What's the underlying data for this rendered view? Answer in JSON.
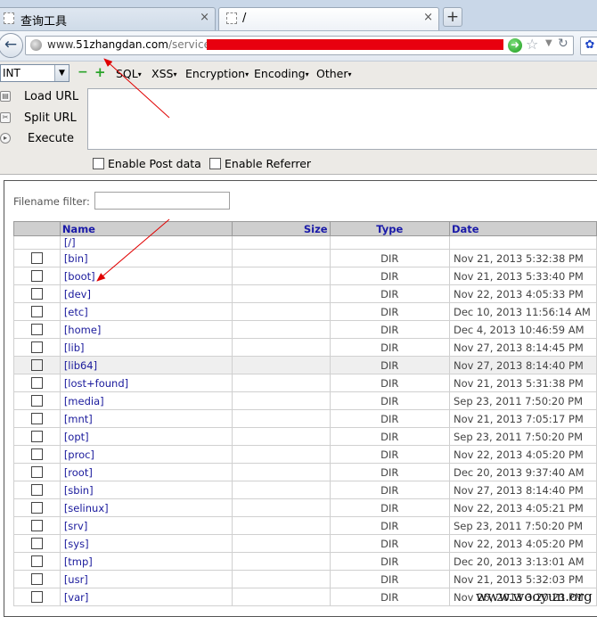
{
  "tabs": [
    {
      "title": "查询工具",
      "close": "×"
    },
    {
      "title": "/",
      "close": "×"
    }
  ],
  "new_tab_label": "+",
  "address": {
    "host_prefix": "www.",
    "host": "51zhangdan.com",
    "path_visible": "/service/",
    "redaction_color": "#e8000f"
  },
  "hackbar": {
    "select_value": "INT",
    "minus": "−",
    "plus": "+",
    "menus": [
      "SQL",
      "XSS",
      "Encryption",
      "Encoding",
      "Other"
    ],
    "actions": [
      "Load URL",
      "Split URL",
      "Execute"
    ],
    "checkboxes": [
      "Enable Post data",
      "Enable Referrer"
    ]
  },
  "filter_label": "Filename filter:",
  "table": {
    "headers": [
      "Name",
      "Size",
      "Type",
      "Date"
    ],
    "parent": "[/]",
    "rows": [
      {
        "name": "[bin]",
        "type": "DIR",
        "date": "Nov 21, 2013 5:32:38 PM"
      },
      {
        "name": "[boot]",
        "type": "DIR",
        "date": "Nov 21, 2013 5:33:40 PM"
      },
      {
        "name": "[dev]",
        "type": "DIR",
        "date": "Nov 22, 2013 4:05:33 PM"
      },
      {
        "name": "[etc]",
        "type": "DIR",
        "date": "Dec 10, 2013 11:56:14 AM"
      },
      {
        "name": "[home]",
        "type": "DIR",
        "date": "Dec 4, 2013 10:46:59 AM"
      },
      {
        "name": "[lib]",
        "type": "DIR",
        "date": "Nov 27, 2013 8:14:45 PM"
      },
      {
        "name": "[lib64]",
        "type": "DIR",
        "date": "Nov 27, 2013 8:14:40 PM"
      },
      {
        "name": "[lost+found]",
        "type": "DIR",
        "date": "Nov 21, 2013 5:31:38 PM"
      },
      {
        "name": "[media]",
        "type": "DIR",
        "date": "Sep 23, 2011 7:50:20 PM"
      },
      {
        "name": "[mnt]",
        "type": "DIR",
        "date": "Nov 21, 2013 7:05:17 PM"
      },
      {
        "name": "[opt]",
        "type": "DIR",
        "date": "Sep 23, 2011 7:50:20 PM"
      },
      {
        "name": "[proc]",
        "type": "DIR",
        "date": "Nov 22, 2013 4:05:20 PM"
      },
      {
        "name": "[root]",
        "type": "DIR",
        "date": "Dec 20, 2013 9:37:40 AM"
      },
      {
        "name": "[sbin]",
        "type": "DIR",
        "date": "Nov 27, 2013 8:14:40 PM"
      },
      {
        "name": "[selinux]",
        "type": "DIR",
        "date": "Nov 22, 2013 4:05:21 PM"
      },
      {
        "name": "[srv]",
        "type": "DIR",
        "date": "Sep 23, 2011 7:50:20 PM"
      },
      {
        "name": "[sys]",
        "type": "DIR",
        "date": "Nov 22, 2013 4:05:20 PM"
      },
      {
        "name": "[tmp]",
        "type": "DIR",
        "date": "Dec 20, 2013 3:13:01 AM"
      },
      {
        "name": "[usr]",
        "type": "DIR",
        "date": "Nov 21, 2013 5:32:03 PM"
      },
      {
        "name": "[var]",
        "type": "DIR",
        "date": "Nov 26, 2013 3:20:23 PM"
      }
    ],
    "highlight_row": 6
  },
  "watermark": "www.wooyun.org",
  "annotation_color": "#e00000"
}
